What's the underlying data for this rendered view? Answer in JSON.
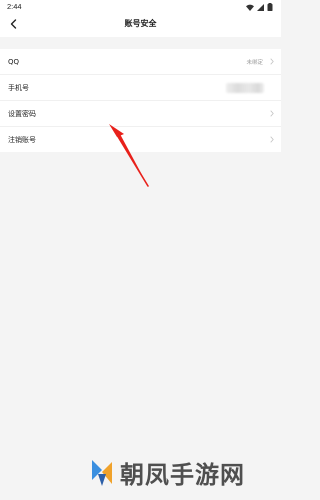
{
  "status_bar": {
    "time": "2:44"
  },
  "header": {
    "title": "账号安全"
  },
  "rows": [
    {
      "label": "QQ",
      "value": "未绑定"
    },
    {
      "label": "手机号",
      "value": ""
    },
    {
      "label": "设置密码",
      "value": ""
    },
    {
      "label": "注销账号",
      "value": ""
    }
  ],
  "watermark": {
    "text": "朝凤手游网"
  },
  "colors": {
    "annotation_red": "#e8211b",
    "background": "#f4f4f4"
  },
  "icons": {
    "back": "chevron-left-icon",
    "chevron": "chevron-right-icon",
    "signal": "signal-icon",
    "wifi": "wifi-icon",
    "battery": "battery-icon"
  }
}
